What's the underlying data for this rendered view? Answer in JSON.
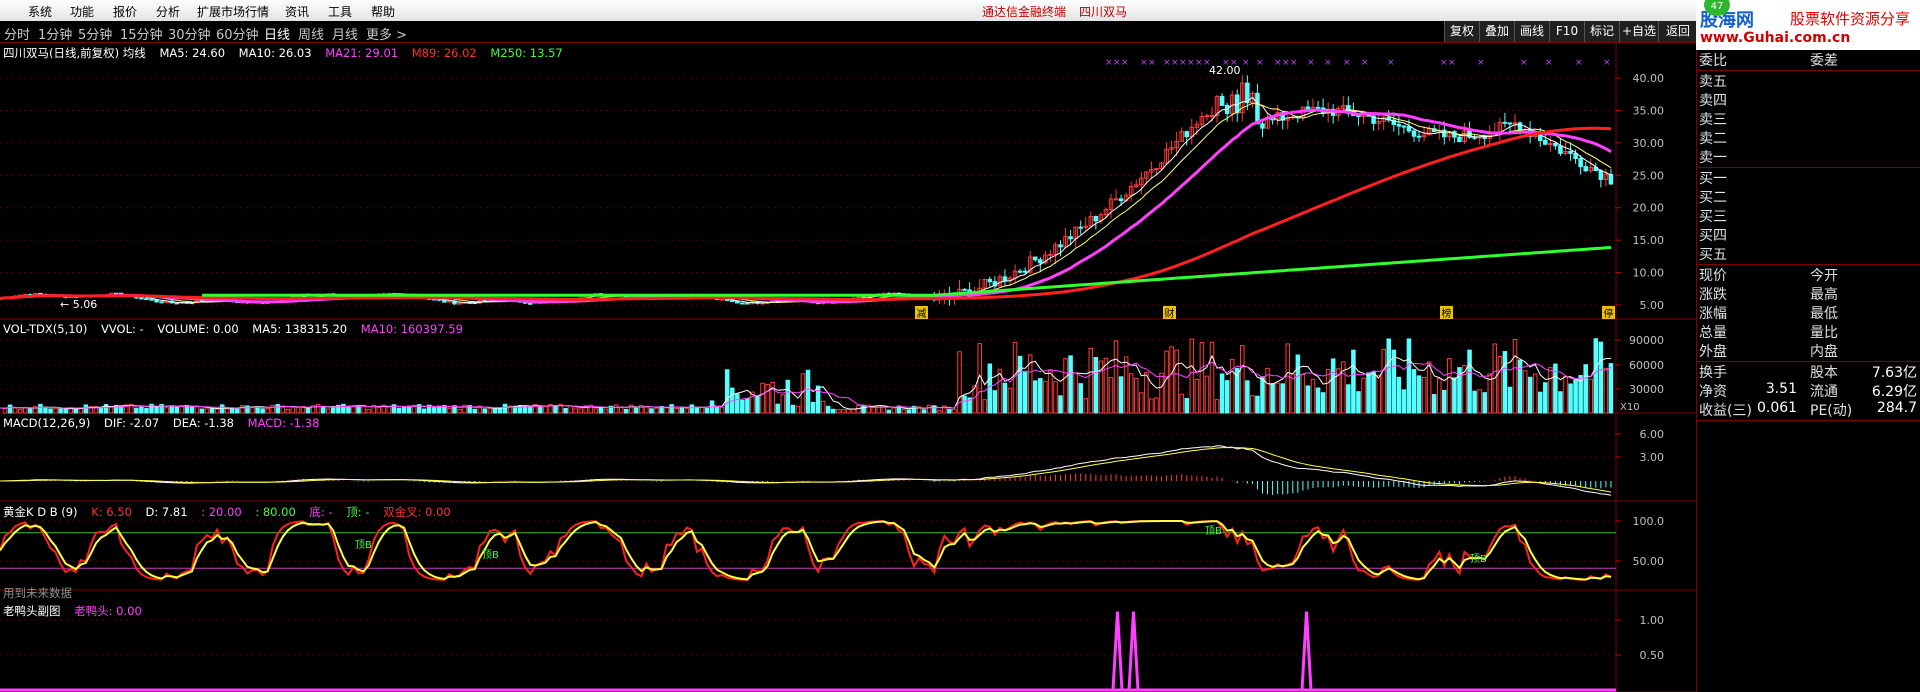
{
  "menu": {
    "items": [
      "系统",
      "功能",
      "报价",
      "分析",
      "扩展市场行情",
      "资讯",
      "工具",
      "帮助"
    ],
    "center_link": "通达信金融终端",
    "center_stock": "四川双马"
  },
  "logo": {
    "brand": "股海网",
    "slogan": "股票软件资源分享",
    "url": "www.Guhai.com.cn",
    "badge": "47"
  },
  "tabs": [
    "分时",
    "1分钟",
    "5分钟",
    "15分钟",
    "30分钟",
    "60分钟",
    "日线",
    "周线",
    "月线",
    "更多 >"
  ],
  "toolbar_buttons": [
    "复权",
    "叠加",
    "画线",
    "F10",
    "标记",
    "+自选",
    "返回"
  ],
  "main": {
    "title": "四川双马(日线,前复权) 均线",
    "mas": [
      {
        "label": "MA5: 24.60",
        "color": "#ffffff"
      },
      {
        "label": "MA10: 26.03",
        "color": "#ffffff"
      },
      {
        "label": "MA21: 29.01",
        "color": "#ff40ff"
      },
      {
        "label": "M89: 26.02",
        "color": "#ff3030"
      },
      {
        "label": "M250: 13.57",
        "color": "#40ff40"
      }
    ],
    "y_ticks": [
      "40.00",
      "35.00",
      "30.00",
      "25.00",
      "20.00",
      "15.00",
      "10.00",
      "5.00"
    ],
    "high_label": "42.00",
    "low_label": "← 5.06",
    "markers": [
      "减",
      "财",
      "榜",
      "停"
    ]
  },
  "vol": {
    "title": "VOL-TDX(5,10)",
    "fields": [
      {
        "label": "VVOL: -",
        "color": "#ffffff"
      },
      {
        "label": "VOLUME: 0.00",
        "color": "#ffffff"
      },
      {
        "label": "MA5: 138315.20",
        "color": "#ffffff"
      },
      {
        "label": "MA10: 160397.59",
        "color": "#ff40ff"
      }
    ],
    "y_ticks": [
      "90000",
      "60000",
      "30000"
    ],
    "unit": "X10"
  },
  "macd": {
    "title": "MACD(12,26,9)",
    "fields": [
      {
        "label": "DIF: -2.07",
        "color": "#ffffff"
      },
      {
        "label": "DEA: -1.38",
        "color": "#ffffff"
      },
      {
        "label": "MACD: -1.38",
        "color": "#ff40ff"
      }
    ],
    "y_ticks": [
      "6.00",
      "3.00"
    ]
  },
  "kdb": {
    "title": "黄金K D B (9)",
    "fields": [
      {
        "label": "K: 6.50",
        "color": "#ff3030"
      },
      {
        "label": "D: 7.81",
        "color": "#ffffff"
      },
      {
        "label": ": 20.00",
        "color": "#ff40ff"
      },
      {
        "label": ": 80.00",
        "color": "#40ff40"
      },
      {
        "label": "底: -",
        "color": "#ff40ff"
      },
      {
        "label": "顶: -",
        "color": "#40ff40"
      },
      {
        "label": "双金叉: 0.00",
        "color": "#ff3030"
      }
    ],
    "y_ticks": [
      "100.0",
      "50.00"
    ],
    "signal_labels": [
      "顶B",
      "顶B",
      "顶B",
      "顶B"
    ],
    "future_note": "用到未来数据"
  },
  "duck": {
    "title": "老鸭头副图",
    "fields": [
      {
        "label": "老鸭头: 0.00",
        "color": "#ff40ff"
      }
    ],
    "y_ticks": [
      "1.00",
      "0.50"
    ]
  },
  "quote": {
    "top": [
      "委比",
      "委差"
    ],
    "sell": [
      "卖五",
      "卖四",
      "卖三",
      "卖二",
      "卖一"
    ],
    "buy": [
      "买一",
      "买二",
      "买三",
      "买四",
      "买五"
    ],
    "grid": [
      [
        "现价",
        "今开"
      ],
      [
        "涨跌",
        "最高"
      ],
      [
        "涨幅",
        "最低"
      ],
      [
        "总量",
        "量比"
      ],
      [
        "外盘",
        "内盘"
      ]
    ],
    "fin": [
      {
        "l": "换手",
        "m": "",
        "r": "股本",
        "v": "7.63亿"
      },
      {
        "l": "净资",
        "m": "3.51",
        "r": "流通",
        "v": "6.29亿"
      },
      {
        "l": "收益(三)",
        "m": "0.061",
        "r": "PE(动)",
        "v": "284.7"
      }
    ]
  }
}
